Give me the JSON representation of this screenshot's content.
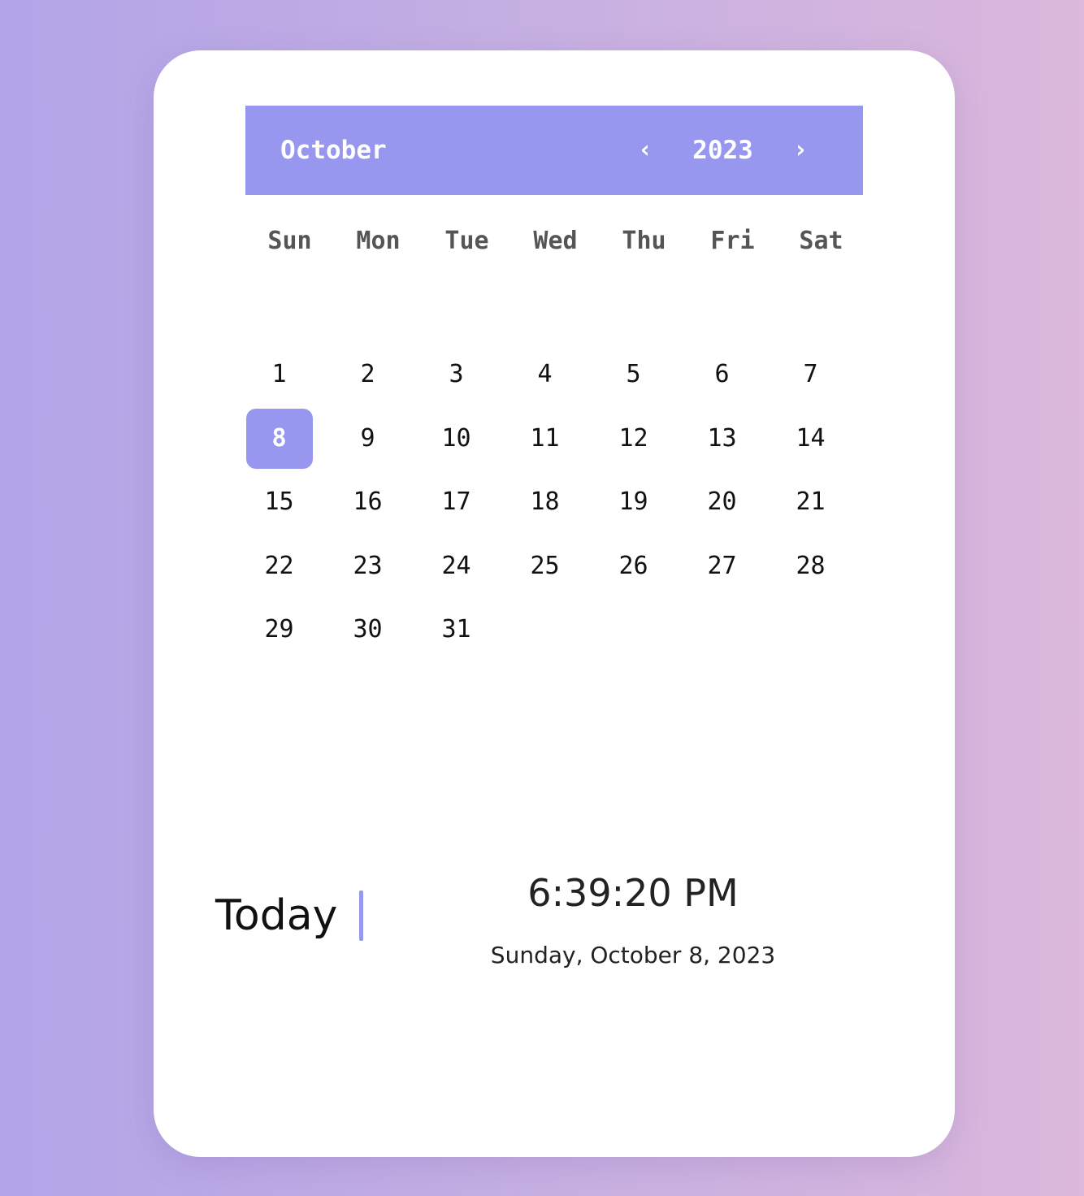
{
  "calendar": {
    "month": "October",
    "year": "2023",
    "prev_icon": "‹",
    "next_icon": "›",
    "weekdays": [
      "Sun",
      "Mon",
      "Tue",
      "Wed",
      "Thu",
      "Fri",
      "Sat"
    ],
    "first_weekday_index": 0,
    "days": [
      "1",
      "2",
      "3",
      "4",
      "5",
      "6",
      "7",
      "8",
      "9",
      "10",
      "11",
      "12",
      "13",
      "14",
      "15",
      "16",
      "17",
      "18",
      "19",
      "20",
      "21",
      "22",
      "23",
      "24",
      "25",
      "26",
      "27",
      "28",
      "29",
      "30",
      "31"
    ],
    "selected_day": "8"
  },
  "today": {
    "label": "Today",
    "time": "6:39:20 PM",
    "date": "Sunday, October 8, 2023"
  },
  "colors": {
    "accent": "#9797ef",
    "background_left": "#b2a4e8",
    "background_right": "#dbb8dc"
  }
}
